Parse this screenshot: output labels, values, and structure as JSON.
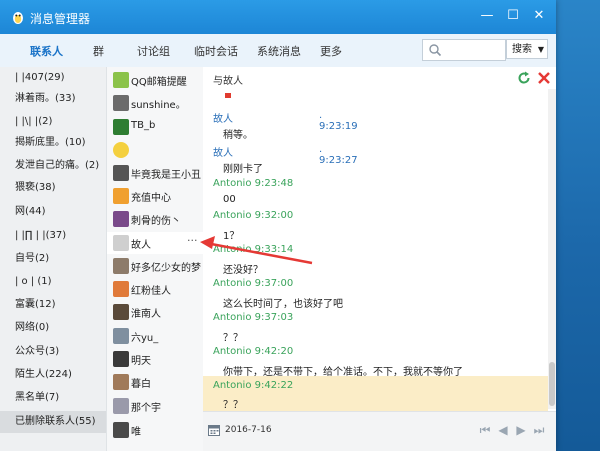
{
  "window": {
    "title": "消息管理器"
  },
  "nav": {
    "tabs": [
      "联系人",
      "群",
      "讨论组",
      "临时会话",
      "系统消息",
      "更多"
    ],
    "active_index": 0,
    "search_scope": "搜索"
  },
  "groups": [
    "| |407(29)",
    "淋着雨。(33)",
    "| |\\| |(2)",
    "揭斯底里。(10)",
    "发泄自己的痛。(2)",
    "猥亵(38)",
    "网(44)",
    "| |∏ | |(37)",
    "自号(2)",
    "| o | (1)",
    "富囊(12)",
    "网络(0)",
    "公众号(3)",
    "陌生人(224)",
    "黑名单(7)",
    "已删除联系人(55)"
  ],
  "selected_group_index": 15,
  "contacts": [
    {
      "name": "QQ邮箱提醒",
      "color": "#8bc34a"
    },
    {
      "name": "sunshine。",
      "color": "#6b6b6b"
    },
    {
      "name": "TB_b",
      "color": "#2e7d32"
    },
    {
      "name": "",
      "color": "#f4d03f"
    },
    {
      "name": "毕竟我是王小丑",
      "color": "#555555"
    },
    {
      "name": "充值中心",
      "color": "#f0a030"
    },
    {
      "name": "刺骨的伤丶",
      "color": "#7a4a8a"
    },
    {
      "name": "故人",
      "color": "#cfcfcf"
    },
    {
      "name": "好多亿少女的梦",
      "color": "#8d7b6a"
    },
    {
      "name": "红粉佳人",
      "color": "#e07a3a"
    },
    {
      "name": "淮南人",
      "color": "#5a4a3a"
    },
    {
      "name": "六yu_",
      "color": "#7f8f9f"
    },
    {
      "name": "明天",
      "color": "#3a3a3a"
    },
    {
      "name": "暮白",
      "color": "#a07a5a"
    },
    {
      "name": "那个宇",
      "color": "#9a9aaa"
    },
    {
      "name": "唯",
      "color": "#4a4a4a"
    }
  ],
  "selected_contact_index": 7,
  "selected_contact_more": "···",
  "chat": {
    "title": "与故人",
    "messages": [
      {
        "sender": "故人",
        "time": ". 9:23:19",
        "text": "稍等。",
        "who": "other"
      },
      {
        "sender": "故人",
        "time": ". 9:23:27",
        "text": "刚刚卡了",
        "who": "other"
      },
      {
        "sender": "Antonio",
        "time": "9:23:48",
        "text": "00",
        "who": "me"
      },
      {
        "sender": "Antonio",
        "time": "9:32:00",
        "text": "1？",
        "who": "me"
      },
      {
        "sender": "Antonio",
        "time": "9:33:14",
        "text": "还没好？",
        "who": "me"
      },
      {
        "sender": "Antonio",
        "time": "9:37:00",
        "text": "这么长时间了，也该好了吧",
        "who": "me"
      },
      {
        "sender": "Antonio",
        "time": "9:37:03",
        "text": "？？",
        "who": "me"
      },
      {
        "sender": "Antonio",
        "time": "9:42:20",
        "text": "你带下，还是不带下，给个准话。不下，我就不等你了",
        "who": "me"
      },
      {
        "sender": "Antonio",
        "time": "9:42:22",
        "text": "？？",
        "who": "me"
      }
    ],
    "footer_date": "2016-7-16"
  },
  "colors": {
    "accent": "#1a73c8",
    "titlebar": "#2196e3",
    "other_sender": "#2a6fb8",
    "me_sender": "#3aa35b",
    "highlight": "#fbedc7",
    "arrow": "#e53935"
  }
}
